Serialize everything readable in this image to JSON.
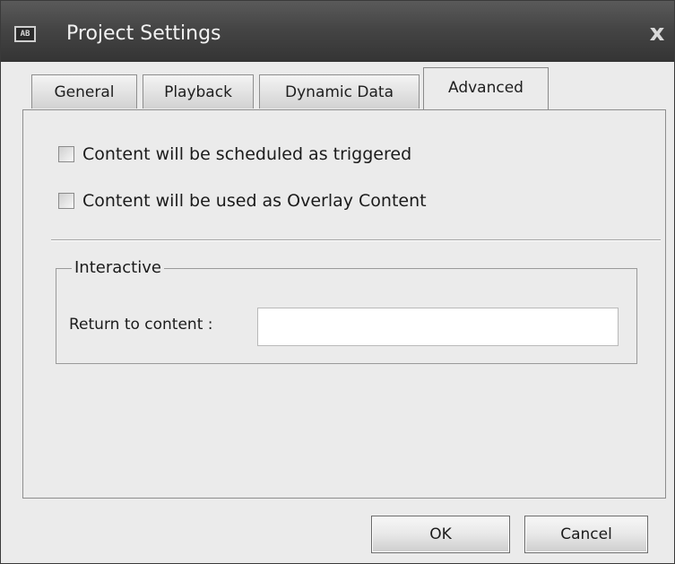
{
  "window": {
    "title": "Project Settings",
    "app_icon_text": "AB",
    "close_glyph": "x",
    "icons": [
      "app-icon",
      "close-icon"
    ]
  },
  "tabs": [
    {
      "label": "General",
      "active": false
    },
    {
      "label": "Playback",
      "active": false
    },
    {
      "label": "Dynamic Data",
      "active": false
    },
    {
      "label": "Advanced",
      "active": true
    }
  ],
  "advanced": {
    "options": [
      {
        "label": "Content will be scheduled as triggered",
        "checked": false
      },
      {
        "label": "Content will be used as Overlay Content",
        "checked": false
      }
    ],
    "interactive_group": {
      "legend": "Interactive",
      "return_label": "Return to content :",
      "return_value": ""
    }
  },
  "buttons": {
    "ok": "OK",
    "cancel": "Cancel"
  },
  "colors": {
    "titlebar": "#454545",
    "dialog_bg": "#ebebeb",
    "title_text": "#f2f2f2"
  }
}
